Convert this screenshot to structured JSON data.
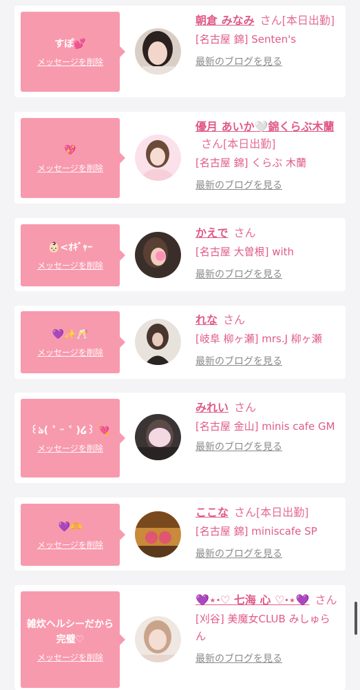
{
  "messages": [
    {
      "message": "すぽ💕",
      "delete_label": "メッセージを削除",
      "name": "朝倉 みなみ",
      "honorific": "さん",
      "badge": "[本日出勤]",
      "shop": "[名古屋 錦] Senten's",
      "blog_label": "最新のブログを見る"
    },
    {
      "message": "💖",
      "delete_label": "メッセージを削除",
      "name": "優月 あいか🤍錦くらぶ木蘭",
      "honorific": "さん",
      "badge": "[本日出勤]",
      "shop": "[名古屋 錦] くらぶ 木蘭",
      "blog_label": "最新のブログを見る"
    },
    {
      "message": "👶🏻<ｵｷﾞｬｰ",
      "delete_label": "メッセージを削除",
      "name": "かえで",
      "honorific": "さん",
      "badge": "",
      "shop": "[名古屋 大曽根] with",
      "blog_label": "最新のブログを見る"
    },
    {
      "message": "💜✨🥂",
      "delete_label": "メッセージを削除",
      "name": "れな",
      "honorific": "さん",
      "badge": "",
      "shop": "[岐阜 柳ヶ瀬] mrs.J 柳ヶ瀬",
      "blog_label": "最新のブログを見る"
    },
    {
      "message": "꒰ঌ( ˃ ᵕ ˂ )໒꒱ 💘",
      "delete_label": "メッセージを削除",
      "name": "みれい",
      "honorific": "さん",
      "badge": "",
      "shop": "[名古屋 金山] minis cafe GM",
      "blog_label": "最新のブログを見る"
    },
    {
      "message": "💜🫶",
      "delete_label": "メッセージを削除",
      "name": "ここな",
      "honorific": "さん",
      "badge": "[本日出勤]",
      "shop": "[名古屋 錦] miniscafe SP",
      "blog_label": "最新のブログを見る"
    },
    {
      "message": "雑炊ヘルシーだから完璧♡",
      "delete_label": "メッセージを削除",
      "name": "💜⋆·♡ 七海 心 ♡·⋆💜",
      "honorific": "さん",
      "badge": "",
      "shop": "[刈谷] 美魔女CLUB みしゅらん",
      "blog_label": "最新のブログを見る"
    }
  ],
  "colors": {
    "accent": "#e05a86",
    "bubble": "#f89aae",
    "card": "#ffffff",
    "background": "#f4f4f6",
    "link_gray": "#8a8a8a"
  }
}
